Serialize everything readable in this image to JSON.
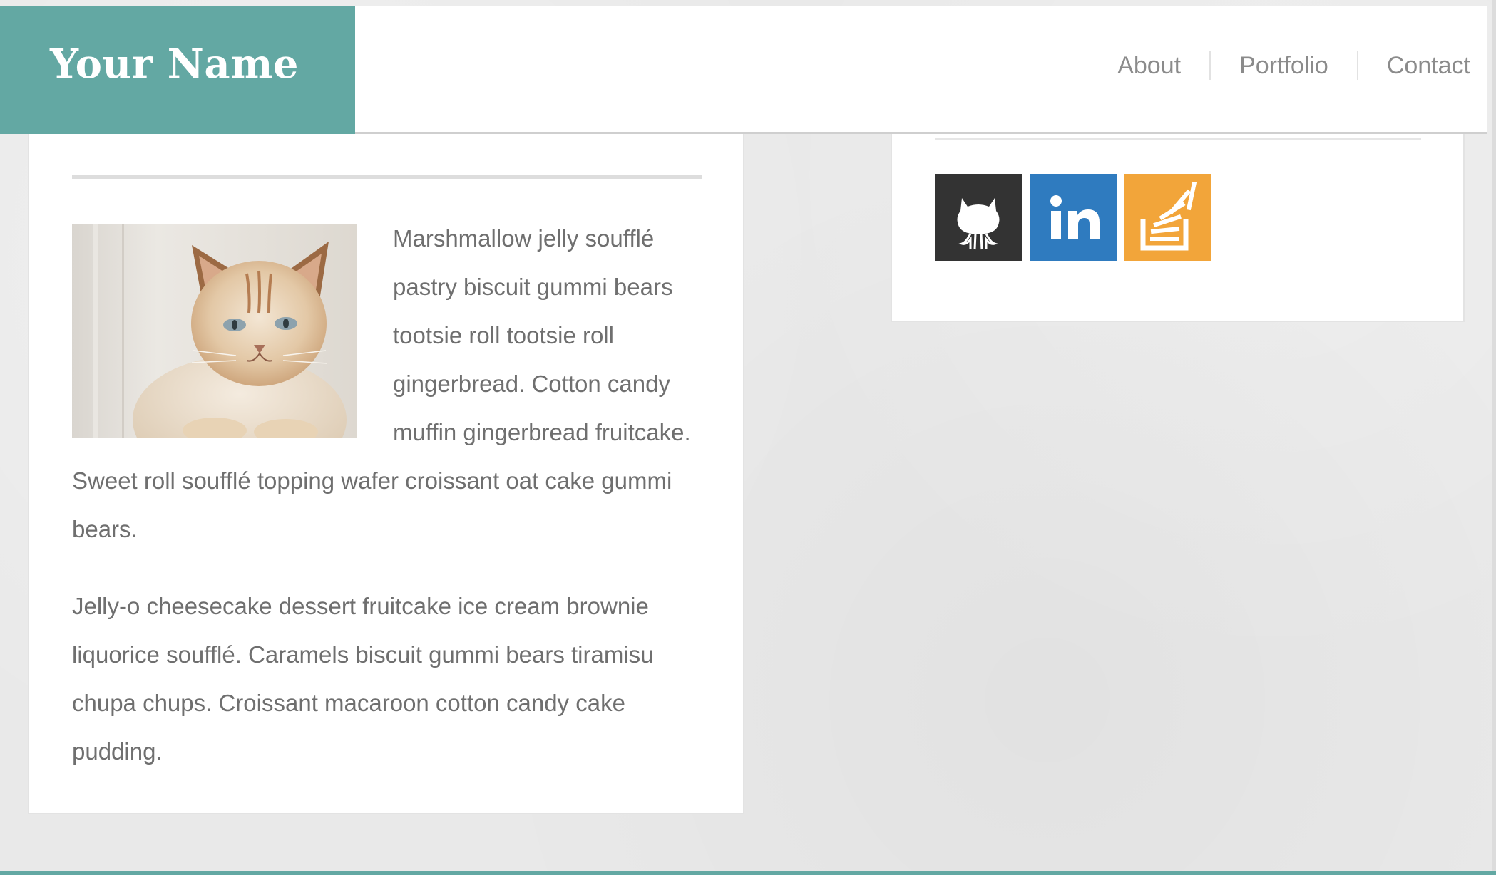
{
  "header": {
    "logo_text": "Your Name",
    "nav": [
      "About",
      "Portfolio",
      "Contact"
    ]
  },
  "main": {
    "image_alt": "cat photo",
    "paragraphs": [
      "Marshmallow jelly soufflé pastry biscuit gummi bears tootsie roll tootsie roll gingerbread. Cotton candy muffin gingerbread fruitcake. Sweet roll soufflé topping wafer croissant oat cake gummi bears.",
      "Jelly-o cheesecake dessert fruitcake ice cream brownie liquorice soufflé. Caramels biscuit gummi bears tiramisu chupa chups. Croissant macaroon cotton candy cake pudding."
    ]
  },
  "sidebar": {
    "social": [
      {
        "icon": "github-icon",
        "color": "#333333"
      },
      {
        "icon": "linkedin-icon",
        "color": "#2f7bbf"
      },
      {
        "icon": "stackoverflow-icon",
        "color": "#f2a53a"
      }
    ]
  },
  "colors": {
    "accent": "#63a8a3",
    "text": "#6f6f6f",
    "nav_text": "#8b8b8b"
  }
}
